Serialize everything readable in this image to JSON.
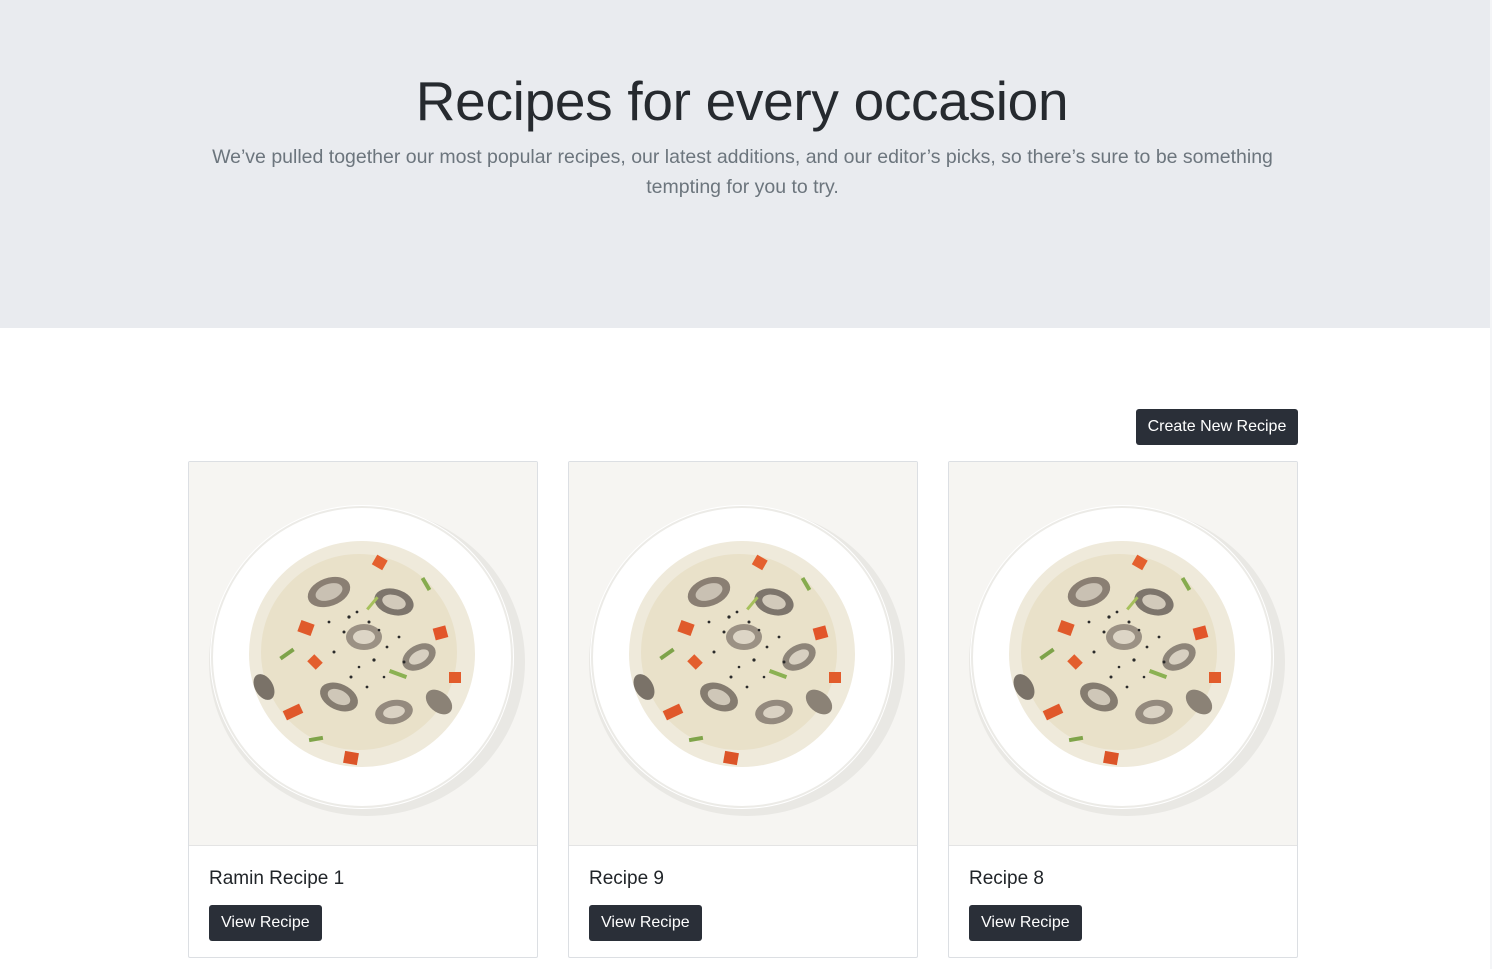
{
  "hero": {
    "title": "Recipes for every occasion",
    "lead": "We’ve pulled together our most popular recipes, our latest additions, and our editor’s picks, so there’s sure to be something tempting for you to try."
  },
  "actions": {
    "create_label": "Create New Recipe"
  },
  "recipes": [
    {
      "title": "Ramin Recipe 1",
      "button_label": "View Recipe",
      "image_icon": "clam-chowder-bowl-image"
    },
    {
      "title": "Recipe 9",
      "button_label": "View Recipe",
      "image_icon": "clam-chowder-bowl-image"
    },
    {
      "title": "Recipe 8",
      "button_label": "View Recipe",
      "image_icon": "clam-chowder-bowl-image"
    }
  ],
  "colors": {
    "hero_bg": "#e9ebef",
    "button_bg": "#2a2f38",
    "lead_text": "#6c757d"
  }
}
